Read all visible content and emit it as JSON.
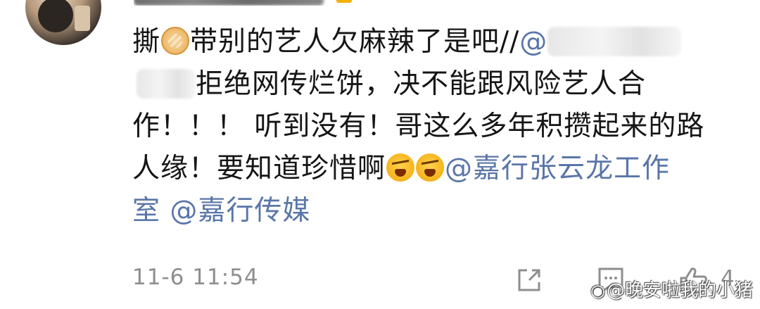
{
  "comment": {
    "line1": {
      "t1": "撕",
      "t2": "带别的艺人欠麻辣了是吧//",
      "t3": "@"
    },
    "line2": {
      "t1": "拒绝网传烂饼，决不能跟风险艺人合"
    },
    "line3": {
      "t1": "作！！！ 听到没有！哥这么多年积攒起来的路"
    },
    "line4": {
      "t1": "人缘！要知道珍惜啊",
      "mention": "@嘉行张云龙工作"
    },
    "line5": {
      "mention_end": "室",
      "mention2": "@嘉行传媒"
    }
  },
  "meta": {
    "timestamp": "11-6 11:54",
    "like_count": "4"
  },
  "watermark": {
    "text": "@晚安啦我的小猪"
  },
  "icons": {
    "pancake": "pancake-emoji-icon",
    "angry": "angry-emoji-icon",
    "repost": "repost-icon",
    "comment": "comment-icon",
    "like": "thumbs-up-icon",
    "weibo": "weibo-logo-icon"
  },
  "colors": {
    "mention": "#5a76a8",
    "text": "#151515",
    "meta": "#8e8e8e"
  }
}
